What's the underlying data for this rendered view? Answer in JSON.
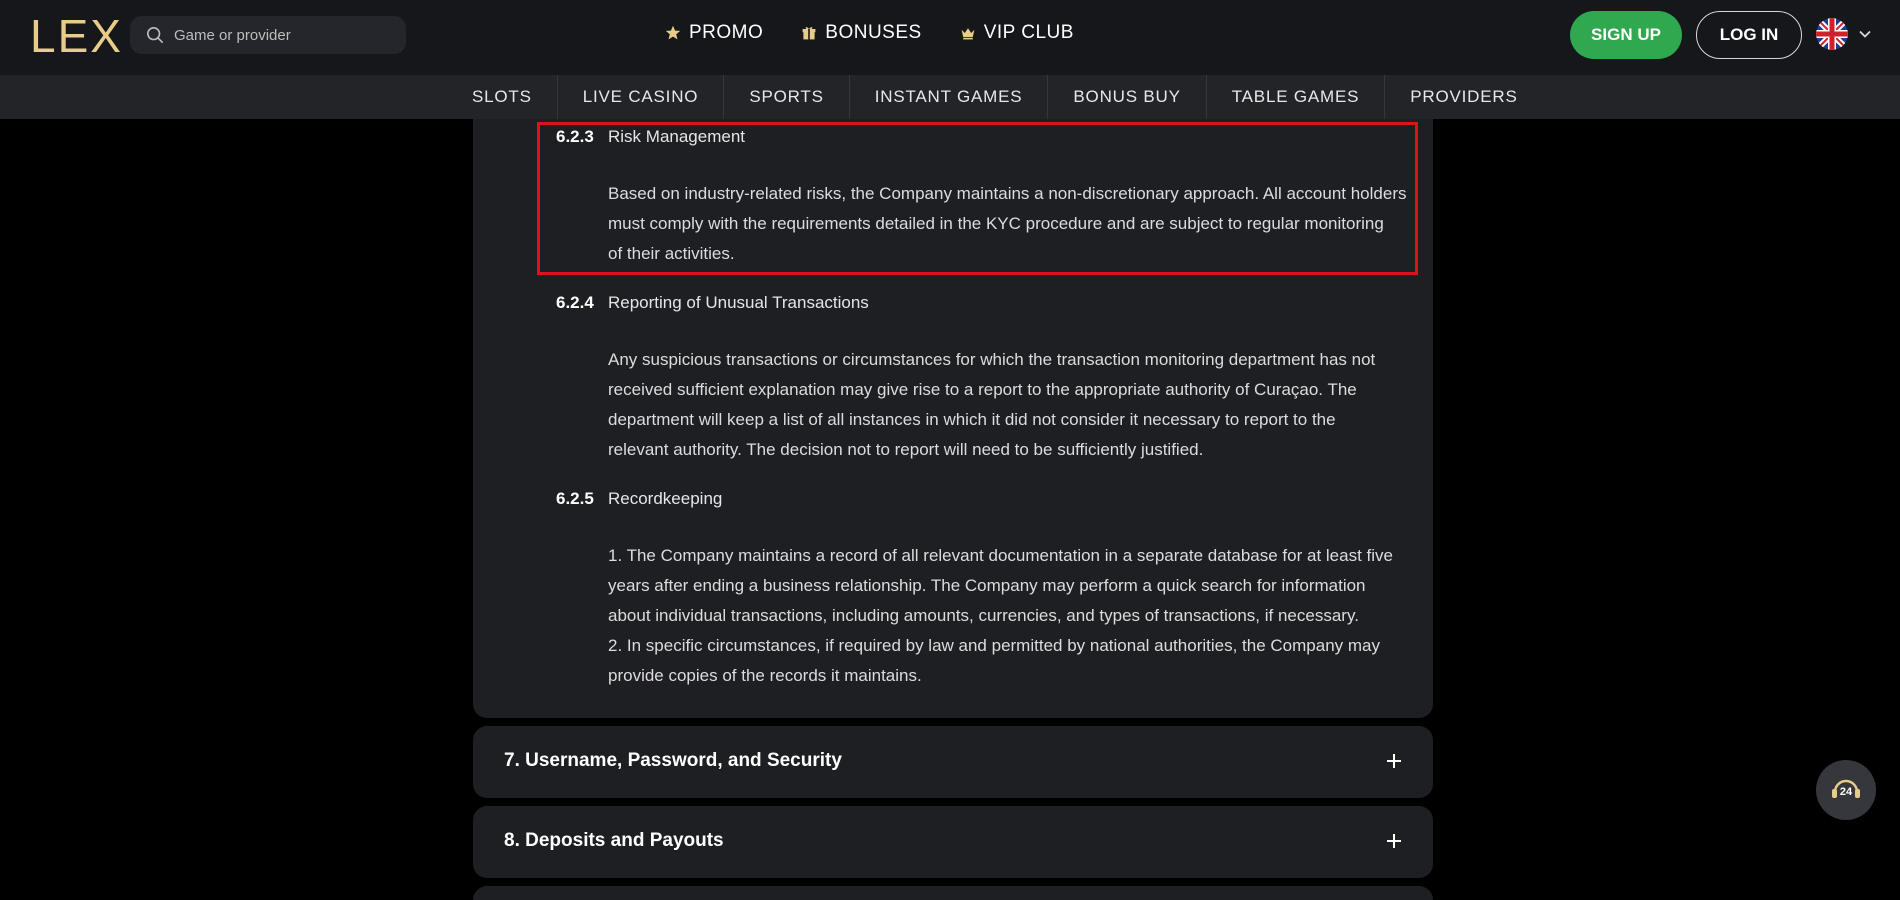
{
  "brand": {
    "logo": "LEX",
    "accent_color": "#e7cc8a"
  },
  "search": {
    "placeholder": "Game or provider"
  },
  "top_nav": [
    {
      "label": "PROMO",
      "icon": "star-icon"
    },
    {
      "label": "BONUSES",
      "icon": "gift-icon"
    },
    {
      "label": "VIP CLUB",
      "icon": "crown-icon"
    }
  ],
  "auth": {
    "signup_label": "SIGN UP",
    "login_label": "LOG IN",
    "signup_color": "#2fa84f"
  },
  "language": {
    "icon": "uk-flag-icon"
  },
  "sub_nav": [
    "SLOTS",
    "LIVE CASINO",
    "SPORTS",
    "INSTANT GAMES",
    "BONUS BUY",
    "TABLE GAMES",
    "PROVIDERS"
  ],
  "sections": [
    {
      "num": "6.2.3",
      "title": "Risk Management",
      "lines": [
        "Based on industry-related risks, the Company maintains a non-discretionary approach. All account holders",
        "must comply with the requirements detailed in the KYC procedure and are subject to regular monitoring",
        "of their activities."
      ]
    },
    {
      "num": "6.2.4",
      "title": "Reporting of Unusual Transactions",
      "lines": [
        "Any suspicious transactions or circumstances for which the transaction monitoring department has not",
        "received sufficient explanation may give rise to a report to the appropriate authority of Curaçao. The",
        "department will keep a list of all instances in which it did not consider it necessary to report to the",
        "relevant authority. The decision not to report will need to be sufficiently justified."
      ]
    },
    {
      "num": "6.2.5",
      "title": "Recordkeeping",
      "lines": [
        "1. The Company maintains a record of all relevant documentation in a separate database for at least five",
        "years after ending a business relationship. The Company may perform a quick search for information",
        "about individual transactions, including amounts, currencies, and types of transactions, if necessary.",
        "2. In specific circumstances, if required by law and permitted by national authorities, the Company may",
        "provide copies of the records it maintains."
      ]
    }
  ],
  "accordions": [
    {
      "label": "7. Username, Password, and Security"
    },
    {
      "label": "8. Deposits and Payouts"
    }
  ],
  "support": {
    "icon": "support-24-icon",
    "label": "24"
  }
}
